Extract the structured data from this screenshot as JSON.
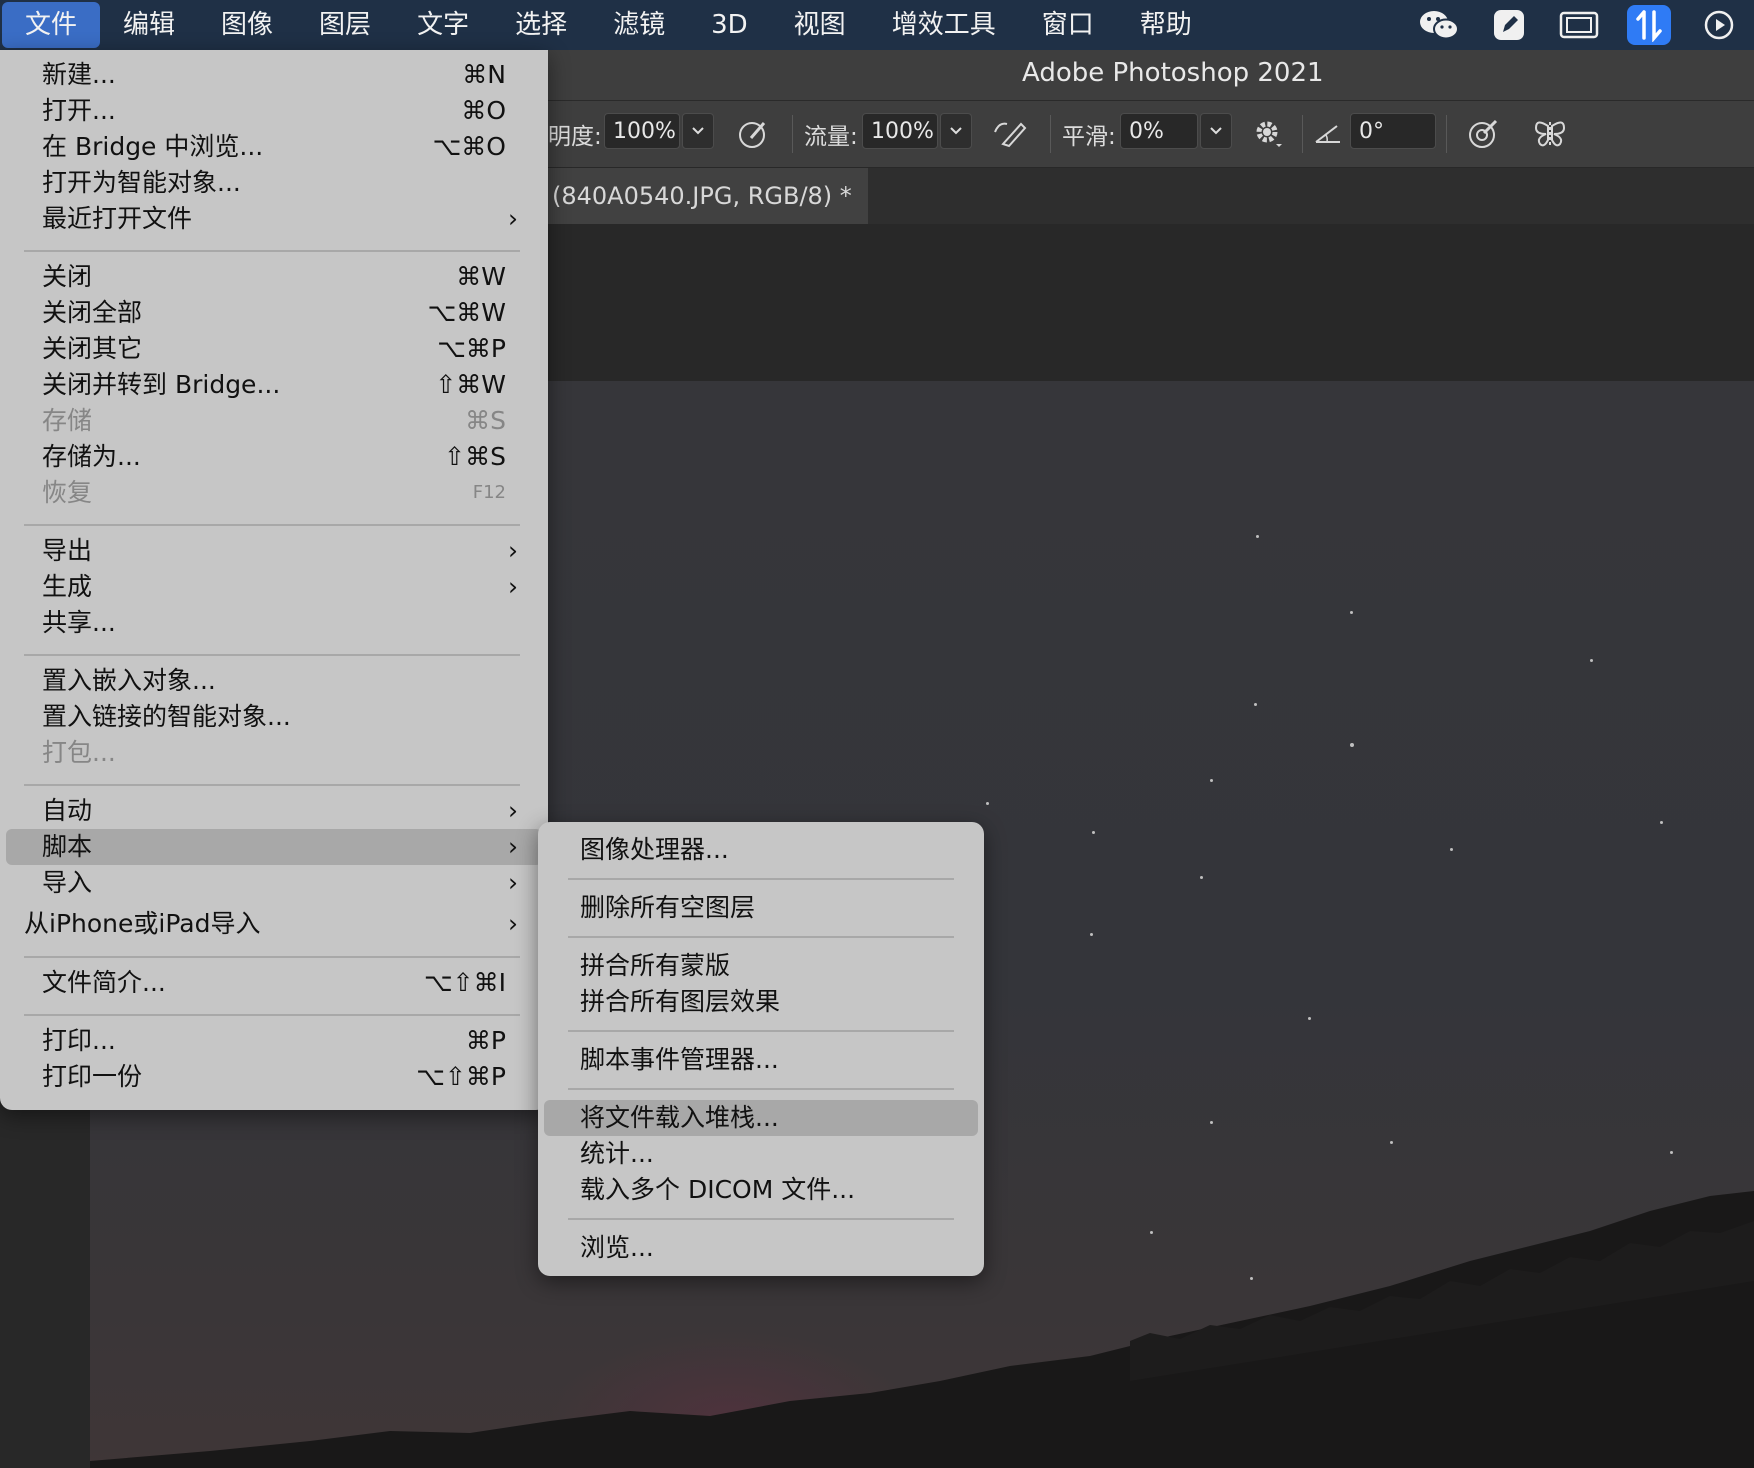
{
  "menubar": {
    "items": [
      "文件",
      "编辑",
      "图像",
      "图层",
      "文字",
      "选择",
      "滤镜",
      "3D",
      "视图",
      "增效工具",
      "窗口",
      "帮助"
    ],
    "active_index": 0
  },
  "status_icons": [
    "wechat-icon",
    "pen-app-icon",
    "display-icon",
    "transfer-app-icon",
    "play-circle-icon"
  ],
  "window": {
    "title": "Adobe Photoshop 2021"
  },
  "options": {
    "opacity_label": "明度:",
    "opacity_value": "100%",
    "flow_label": "流量:",
    "flow_value": "100%",
    "smoothing_label": "平滑:",
    "smoothing_value": "0%",
    "angle_value": "0°"
  },
  "document": {
    "tab_title": "(840A0540.JPG, RGB/8) *"
  },
  "file_menu": {
    "items": [
      {
        "label": "新建...",
        "shortcut": "⌘N"
      },
      {
        "label": "打开...",
        "shortcut": "⌘O"
      },
      {
        "label": "在 Bridge 中浏览...",
        "shortcut": "⌥⌘O"
      },
      {
        "label": "打开为智能对象..."
      },
      {
        "label": "最近打开文件",
        "submenu": true
      },
      {
        "label": "关闭",
        "shortcut": "⌘W"
      },
      {
        "label": "关闭全部",
        "shortcut": "⌥⌘W"
      },
      {
        "label": "关闭其它",
        "shortcut": "⌥⌘P"
      },
      {
        "label": "关闭并转到 Bridge...",
        "shortcut": "⇧⌘W"
      },
      {
        "label": "存储",
        "shortcut": "⌘S",
        "disabled": true
      },
      {
        "label": "存储为...",
        "shortcut": "⇧⌘S"
      },
      {
        "label": "恢复",
        "shortcut": "F12",
        "disabled": true
      },
      {
        "label": "导出",
        "submenu": true
      },
      {
        "label": "生成",
        "submenu": true
      },
      {
        "label": "共享..."
      },
      {
        "label": "置入嵌入对象..."
      },
      {
        "label": "置入链接的智能对象..."
      },
      {
        "label": "打包...",
        "disabled": true
      },
      {
        "label": "自动",
        "submenu": true
      },
      {
        "label": "脚本",
        "submenu": true,
        "selected": true
      },
      {
        "label": "导入",
        "submenu": true
      },
      {
        "label": "从iPhone或iPad导入",
        "submenu": true
      },
      {
        "label": "文件简介...",
        "shortcut": "⌥⇧⌘I"
      },
      {
        "label": "打印...",
        "shortcut": "⌘P"
      },
      {
        "label": "打印一份",
        "shortcut": "⌥⇧⌘P"
      }
    ]
  },
  "scripts_submenu": {
    "items": [
      {
        "label": "图像处理器..."
      },
      {
        "label": "删除所有空图层"
      },
      {
        "label": "拼合所有蒙版"
      },
      {
        "label": "拼合所有图层效果"
      },
      {
        "label": "脚本事件管理器..."
      },
      {
        "label": "将文件载入堆栈...",
        "selected": true
      },
      {
        "label": "统计..."
      },
      {
        "label": "载入多个 DICOM 文件..."
      },
      {
        "label": "浏览..."
      }
    ]
  }
}
